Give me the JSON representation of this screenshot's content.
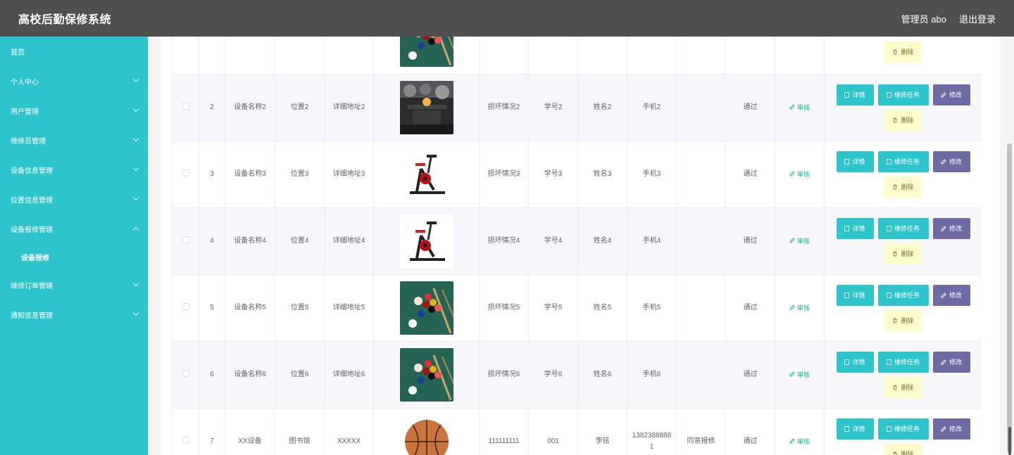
{
  "header": {
    "title": "高校后勤保修系统",
    "user": "管理员 abo",
    "logout": "退出登录"
  },
  "sidebar": {
    "items": [
      {
        "label": "首页",
        "chevron": "none"
      },
      {
        "label": "个人中心",
        "chevron": "down"
      },
      {
        "label": "用户管理",
        "chevron": "down"
      },
      {
        "label": "维修员管理",
        "chevron": "down"
      },
      {
        "label": "设备信息管理",
        "chevron": "down"
      },
      {
        "label": "位置信息管理",
        "chevron": "down"
      },
      {
        "label": "设备报修管理",
        "chevron": "up"
      },
      {
        "label": "设备报修",
        "chevron": "none",
        "sub": true
      },
      {
        "label": "维修订单管理",
        "chevron": "down"
      },
      {
        "label": "通知信息管理",
        "chevron": "down"
      }
    ]
  },
  "table": {
    "actions": {
      "detail": "详情",
      "task": "维修任务",
      "edit": "修改",
      "delete": "删除",
      "audit": "审核"
    },
    "rows": [
      {
        "index": "",
        "name": "",
        "location": "",
        "address": "",
        "image": "billiards",
        "damage": "",
        "student_id": "",
        "student_name": "",
        "phone": "",
        "reply": "",
        "status": "",
        "partial": true
      },
      {
        "index": "2",
        "name": "设备名称2",
        "location": "位置2",
        "address": "详细地址2",
        "image": "gym",
        "damage": "损坏情况2",
        "student_id": "学号2",
        "student_name": "姓名2",
        "phone": "手机2",
        "reply": "",
        "status": "通过"
      },
      {
        "index": "3",
        "name": "设备名称3",
        "location": "位置3",
        "address": "详细地址3",
        "image": "bike",
        "damage": "损坏情况3",
        "student_id": "学号3",
        "student_name": "姓名3",
        "phone": "手机3",
        "reply": "",
        "status": "通过"
      },
      {
        "index": "4",
        "name": "设备名称4",
        "location": "位置4",
        "address": "详细地址4",
        "image": "bike",
        "damage": "损坏情况4",
        "student_id": "学号4",
        "student_name": "姓名4",
        "phone": "手机4",
        "reply": "",
        "status": "通过"
      },
      {
        "index": "5",
        "name": "设备名称5",
        "location": "位置5",
        "address": "详细地址5",
        "image": "billiards",
        "damage": "损坏情况5",
        "student_id": "学号5",
        "student_name": "姓名5",
        "phone": "手机5",
        "reply": "",
        "status": "通过"
      },
      {
        "index": "6",
        "name": "设备名称6",
        "location": "位置6",
        "address": "详细地址6",
        "image": "billiards",
        "damage": "损坏情况6",
        "student_id": "学号6",
        "student_name": "姓名6",
        "phone": "手机6",
        "reply": "",
        "status": "通过"
      },
      {
        "index": "7",
        "name": "XX设备",
        "location": "图书馆",
        "address": "XXXXX",
        "image": "basketball",
        "damage": "111111111",
        "student_id": "001",
        "student_name": "李铭",
        "phone": "13823888881",
        "reply": "同意报修",
        "status": "通过"
      }
    ]
  },
  "colors": {
    "header_bg": "#4f4f4f",
    "sidebar_bg": "#2ec4cc",
    "accent_teal": "#2ec4cc",
    "edit_purple": "#6e6aa4",
    "delete_yellow": "#fdfbcc",
    "audit_green": "#19b38d"
  }
}
